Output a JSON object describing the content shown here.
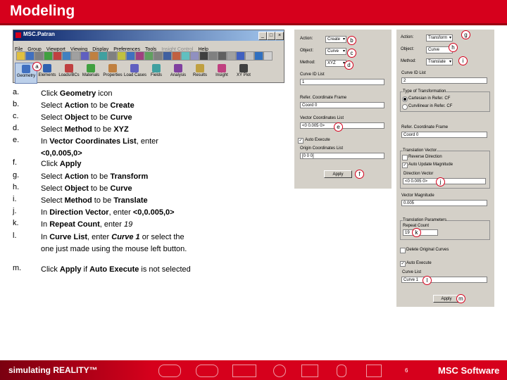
{
  "header": {
    "title": "Modeling"
  },
  "patran": {
    "title": "MSC.Patran",
    "menus": [
      "File",
      "Group",
      "Viewport",
      "Viewing",
      "Display",
      "Preferences",
      "Tools",
      "Insight Control",
      "Help"
    ],
    "apps": [
      "Geometry",
      "Elements",
      "Loads/BCs",
      "Materials",
      "Properties",
      "Load Cases",
      "Fields",
      "Analysis",
      "Results",
      "Insight",
      "XY Plot"
    ]
  },
  "steps": [
    {
      "letter": "a.",
      "parts": [
        [
          "Click ",
          ""
        ],
        [
          "Geometry",
          "b"
        ],
        [
          " icon",
          ""
        ]
      ]
    },
    {
      "letter": "b.",
      "parts": [
        [
          "Select ",
          ""
        ],
        [
          "Action",
          "b"
        ],
        [
          " to be ",
          ""
        ],
        [
          "Create",
          "b"
        ]
      ]
    },
    {
      "letter": "c.",
      "parts": [
        [
          "Select ",
          ""
        ],
        [
          "Object",
          "b"
        ],
        [
          " to be ",
          ""
        ],
        [
          "Curve",
          "b"
        ]
      ]
    },
    {
      "letter": "d.",
      "parts": [
        [
          "Select ",
          ""
        ],
        [
          "Method",
          "b"
        ],
        [
          " to be ",
          ""
        ],
        [
          "XYZ",
          "b"
        ]
      ]
    },
    {
      "letter": "e.",
      "parts": [
        [
          "In ",
          ""
        ],
        [
          "Vector Coordinates List",
          "b"
        ],
        [
          ", enter ",
          ""
        ],
        [
          "<0,0.005,0>",
          "b"
        ]
      ]
    },
    {
      "letter": "f.",
      "parts": [
        [
          "Click ",
          ""
        ],
        [
          "Apply",
          "b"
        ]
      ]
    },
    {
      "letter": "g.",
      "parts": [
        [
          "Select ",
          ""
        ],
        [
          "Action",
          "b"
        ],
        [
          " to be ",
          ""
        ],
        [
          "Transform",
          "b"
        ]
      ]
    },
    {
      "letter": "h.",
      "parts": [
        [
          "Select ",
          ""
        ],
        [
          "Object",
          "b"
        ],
        [
          " to be ",
          ""
        ],
        [
          "Curve",
          "b"
        ]
      ]
    },
    {
      "letter": "i.",
      "parts": [
        [
          "Select ",
          ""
        ],
        [
          "Method",
          "b"
        ],
        [
          " to be ",
          ""
        ],
        [
          "Translate",
          "b"
        ]
      ]
    },
    {
      "letter": "j.",
      "parts": [
        [
          "In ",
          ""
        ],
        [
          "Direction Vector",
          "b"
        ],
        [
          ", enter ",
          ""
        ],
        [
          "<0,0.005,0>",
          "b"
        ]
      ]
    },
    {
      "letter": "k.",
      "parts": [
        [
          "In ",
          ""
        ],
        [
          "Repeat Count",
          "b"
        ],
        [
          ", enter ",
          ""
        ],
        [
          "19",
          "i"
        ]
      ]
    },
    {
      "letter": "l.",
      "parts": [
        [
          "In ",
          ""
        ],
        [
          "Curve List",
          "b"
        ],
        [
          ", enter ",
          ""
        ],
        [
          "Curve 1",
          "bi"
        ],
        [
          " or select the one just made using the mouse left button.",
          ""
        ]
      ]
    },
    {
      "letter": "m.",
      "parts": [
        [
          "Click ",
          ""
        ],
        [
          "Apply",
          "b"
        ],
        [
          " if ",
          ""
        ],
        [
          "Auto Execute",
          "b"
        ],
        [
          " is not selected",
          ""
        ]
      ]
    }
  ],
  "panel1": {
    "action_label": "Action:",
    "action": "Create",
    "object_label": "Object:",
    "object": "Curve",
    "method_label": "Method:",
    "method": "XYZ",
    "curve_id_label": "Curve ID List",
    "curve_id": "1",
    "refcoord_label": "Refer. Coordinate Frame",
    "refcoord": "Coord 0",
    "vector_label": "Vector Coordinates List",
    "vector": "<0 0.005 0>",
    "auto_label": "Auto Execute",
    "origin_label": "Origin Coordinates List",
    "origin": "[0 0 0]",
    "apply": "Apply"
  },
  "panel2": {
    "action_label": "Action:",
    "action": "Transform",
    "object_label": "Object:",
    "object": "Curve",
    "method_label": "Method:",
    "method": "Translate",
    "curve_id_label": "Curve ID List",
    "curve_id": "2",
    "type_label": "Type of Transformation",
    "cart_label": "Cartesian in Refer. CF",
    "curv_label": "Curvilinear in Refer. CF",
    "refcoord_label": "Refer. Coordinate Frame",
    "refcoord": "Coord 0",
    "trans_label": "Translation Vector",
    "reverse_label": "Reverse Direction",
    "automag_label": "Auto Update Magnitude",
    "dirvec_label": "Direction Vector",
    "dirvec": "<0 0.005 0>",
    "mag_label": "Vector Magnitude",
    "mag": "0.005",
    "param_label": "Translation Parameters",
    "repeat_label": "Repeat Count",
    "repeat": "19",
    "delete_label": "Delete Original Curves",
    "auto_label": "Auto Execute",
    "curvelist_label": "Curve List",
    "curvelist": "Curve 1",
    "apply": "Apply"
  },
  "callouts": [
    "a",
    "b",
    "c",
    "d",
    "e",
    "f",
    "g",
    "h",
    "i",
    "j",
    "k",
    "l",
    "m"
  ],
  "footer": {
    "tagline": "simulating REALITY™",
    "page": "6",
    "logo": "MSC Software"
  },
  "colors": {
    "brand_red": "#d6001c",
    "panel_gray": "#d4d0c8",
    "title_blue": "#0a246a"
  }
}
